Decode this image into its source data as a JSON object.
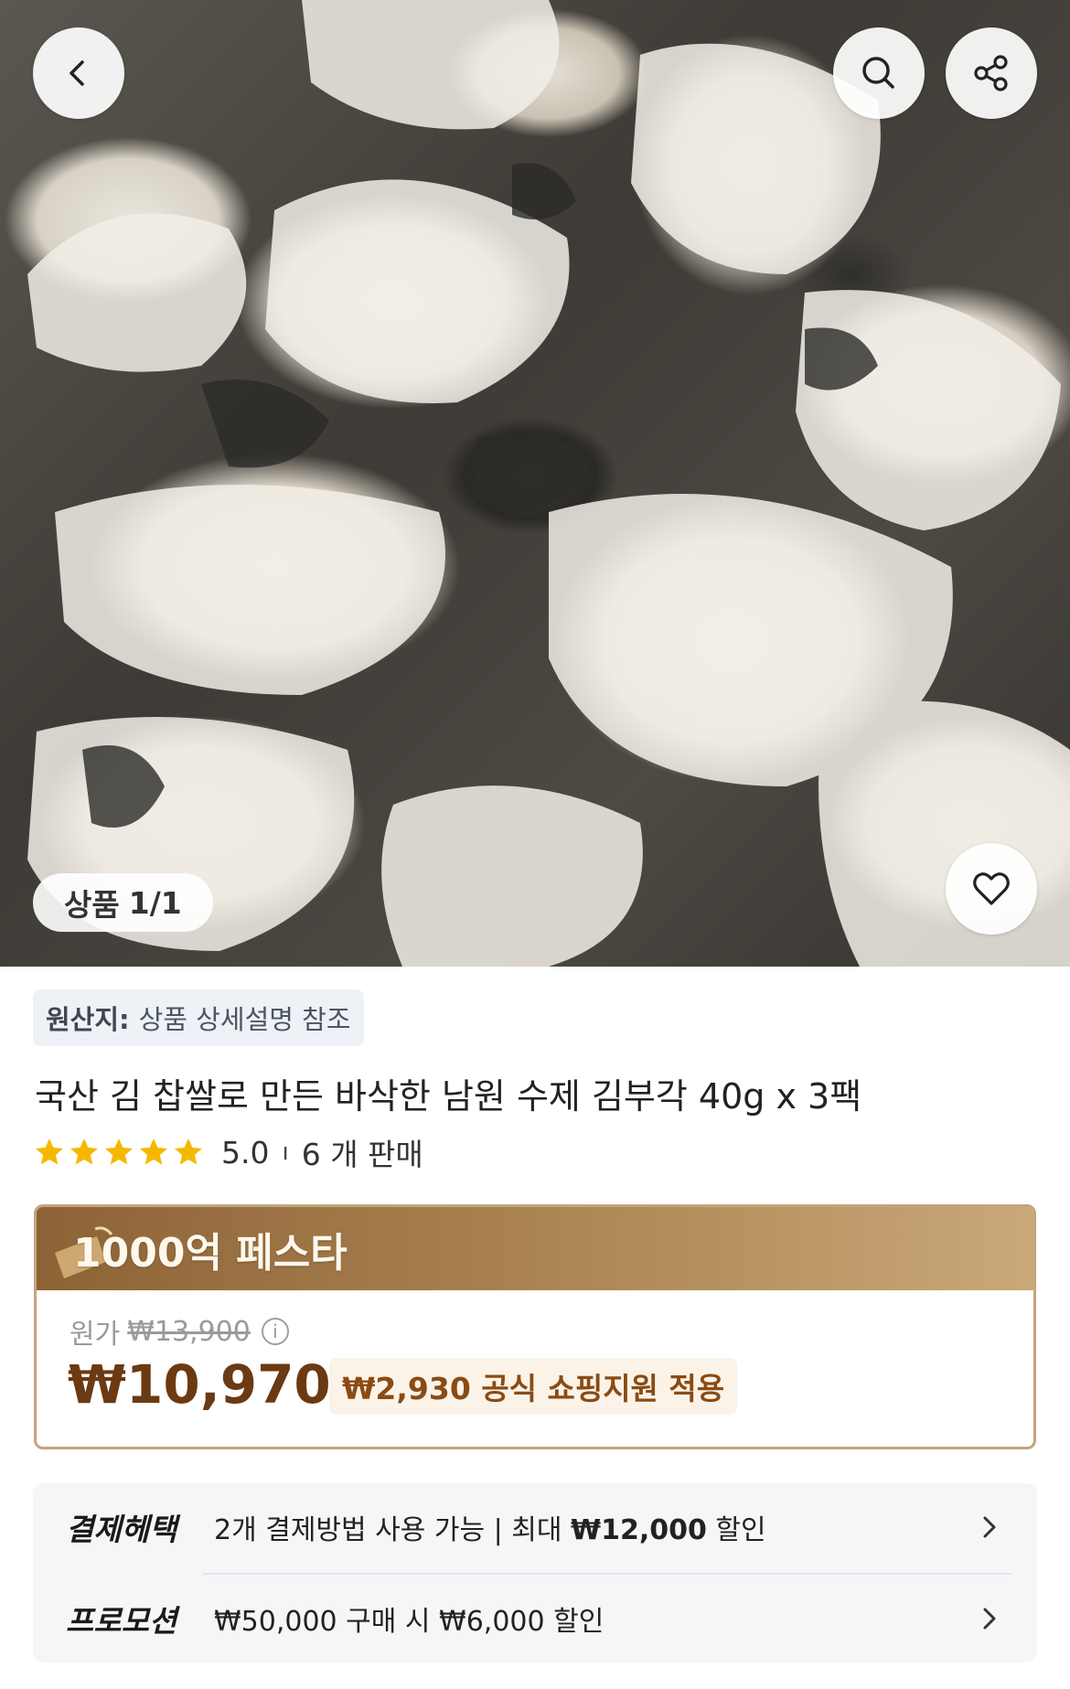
{
  "header": {
    "back_icon": "chevron-left-icon",
    "search_icon": "search-icon",
    "share_icon": "share-icon"
  },
  "gallery": {
    "counter_label": "상품",
    "counter_value": "1/1",
    "like_icon": "heart-icon"
  },
  "origin": {
    "label": "원산지:",
    "value": "상품 상세설명 참조"
  },
  "product": {
    "title": "국산 김 찹쌀로 만든 바삭한 남원 수제 김부각 40g x 3팩",
    "rating": "5.0",
    "rating_separator": "ı",
    "sales": "6 개 판매",
    "star_count": 5,
    "star_color": "#f5b800"
  },
  "promo": {
    "title": "1000억 페스타",
    "original_label": "원가",
    "original_price": "₩13,900",
    "sale_price": "₩10,970",
    "support_text": "₩2,930 공식 쇼핑지원 적용",
    "accent_color": "#6b3a12",
    "border_color": "#c4a47d"
  },
  "benefits": {
    "payment_label": "결제헤택",
    "payment_text_pre": "2개 결제방법 사용 가능 | 최대 ",
    "payment_amount": "₩12,000",
    "payment_text_post": " 할인",
    "promotion_label": "프로모션",
    "promotion_text": "₩50,000 구매 시 ₩6,000 할인"
  }
}
